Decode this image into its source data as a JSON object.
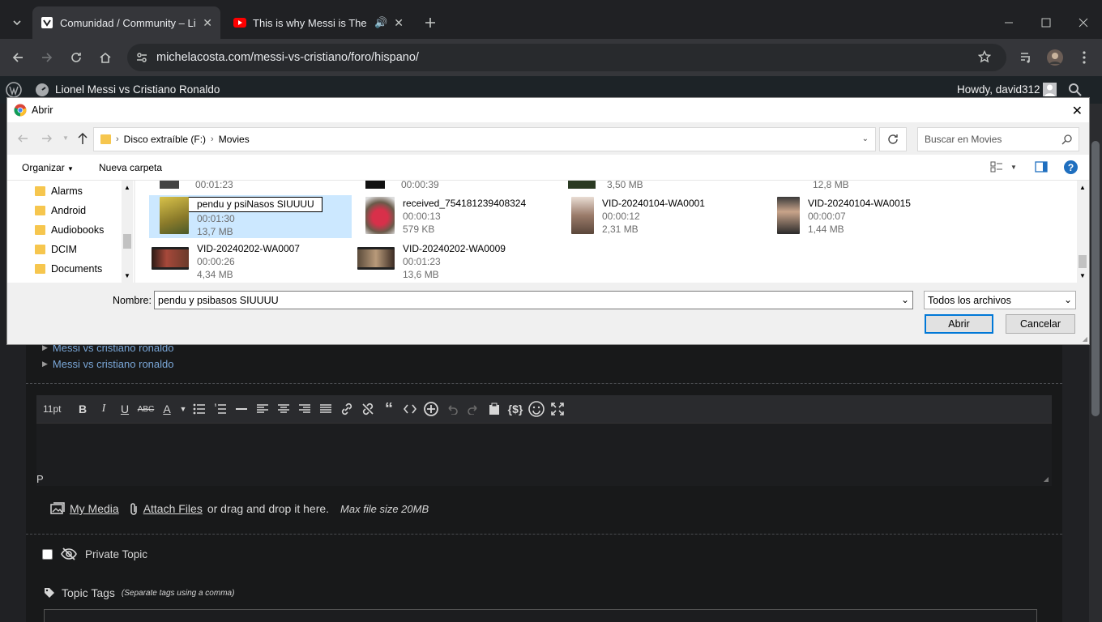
{
  "browser": {
    "tabs": [
      {
        "title": "Comunidad / Community – Lionel",
        "active": true
      },
      {
        "title": "This is why Messi is The BEST",
        "active": false
      }
    ],
    "url": "michelacosta.com/messi-vs-cristiano/foro/hispano/"
  },
  "wp": {
    "site_title": "Lionel Messi vs Cristiano Ronaldo",
    "howdy": "Howdy, david312"
  },
  "page": {
    "topic_links": [
      "Messi vs cristiano ronaldo",
      "Messi vs cristiano ronaldo"
    ],
    "editor": {
      "font_size": "11pt",
      "path": "P"
    },
    "media": {
      "my_media": "My Media",
      "attach_files": "Attach Files",
      "drag_text": "or drag and drop it here.",
      "max_size": "Max file size 20MB"
    },
    "private_topic": "Private Topic",
    "topic_tags": "Topic Tags",
    "tags_hint": "(Separate tags using a comma)"
  },
  "dialog": {
    "title": "Abrir",
    "breadcrumb": [
      "Disco extraíble (F:)",
      "Movies"
    ],
    "search_placeholder": "Buscar en Movies",
    "organize": "Organizar",
    "new_folder": "Nueva carpeta",
    "nav_items": [
      "Alarms",
      "Android",
      "Audiobooks",
      "DCIM",
      "Documents"
    ],
    "partial_row": [
      {
        "duration": "00:01:23"
      },
      {
        "duration": "00:00:39"
      },
      {
        "size": "3,50 MB"
      },
      {
        "size": "12,8 MB"
      }
    ],
    "files": [
      {
        "name": "pendu y psiNasos SIUUUU",
        "duration": "00:01:30",
        "size": "13,7 MB",
        "selected": true
      },
      {
        "name": "received_754181239408324",
        "duration": "00:00:13",
        "size": "579 KB"
      },
      {
        "name": "VID-20240104-WA0001",
        "duration": "00:00:12",
        "size": "2,31 MB"
      },
      {
        "name": "VID-20240104-WA0015",
        "duration": "00:00:07",
        "size": "1,44 MB"
      },
      {
        "name": "VID-20240202-WA0007",
        "duration": "00:00:26",
        "size": "4,34 MB"
      },
      {
        "name": "VID-20240202-WA0009",
        "duration": "00:01:23",
        "size": "13,6 MB"
      }
    ],
    "filename_label": "Nombre:",
    "filename_value": "pendu y psibasos SIUUUU",
    "filetype": "Todos los archivos",
    "open_button": "Abrir",
    "cancel_button": "Cancelar"
  }
}
